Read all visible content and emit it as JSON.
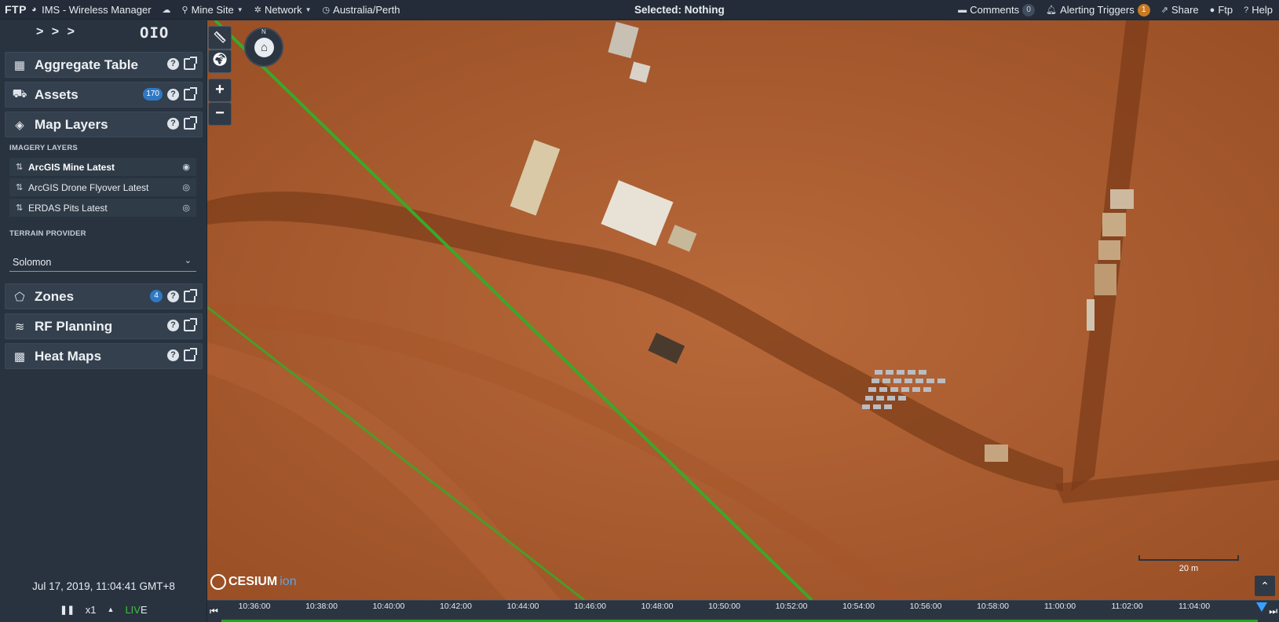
{
  "topbar": {
    "brand": "FTP",
    "app_title": "IMS - Wireless Manager",
    "mine_site": "Mine Site",
    "network": "Network",
    "timezone": "Australia/Perth",
    "selected": "Selected: Nothing",
    "comments_label": "Comments",
    "comments_count": "0",
    "alerting_label": "Alerting Triggers",
    "alerting_count": "1",
    "share_label": "Share",
    "user_label": "Ftp",
    "help_label": "Help"
  },
  "sidebar": {
    "toggle_arrows": "> > >",
    "logo_text": "OIO",
    "panels": {
      "aggregate_table": {
        "title": "Aggregate Table"
      },
      "assets": {
        "title": "Assets",
        "count": "170"
      },
      "map_layers": {
        "title": "Map Layers"
      },
      "zones": {
        "title": "Zones",
        "count": "4"
      },
      "rf_planning": {
        "title": "RF Planning"
      },
      "heat_maps": {
        "title": "Heat Maps"
      }
    },
    "imagery_label": "IMAGERY LAYERS",
    "layers": [
      {
        "name": "ArcGIS Mine Latest",
        "visible": true
      },
      {
        "name": "ArcGIS Drone Flyover Latest",
        "visible": false
      },
      {
        "name": "ERDAS Pits Latest",
        "visible": false
      }
    ],
    "terrain_label": "TERRAIN PROVIDER",
    "terrain_value": "Solomon",
    "clock": "Jul 17, 2019, 11:04:41 GMT+8",
    "speed": "x1",
    "live_prefix": "LIV",
    "live_suffix": "E"
  },
  "map": {
    "compass_north": "N",
    "zoom_in": "+",
    "zoom_out": "−",
    "cesium_text": "CESIUM",
    "cesium_ion": "ion",
    "scale_label": "20 m",
    "colors": {
      "ground": "#a85a2c",
      "line": "#3aa829"
    }
  },
  "timeline": {
    "ticks": [
      "10:36:00",
      "10:38:00",
      "10:40:00",
      "10:42:00",
      "10:44:00",
      "10:46:00",
      "10:48:00",
      "10:50:00",
      "10:52:00",
      "10:54:00",
      "10:56:00",
      "10:58:00",
      "11:00:00",
      "11:02:00",
      "11:04:00"
    ]
  }
}
